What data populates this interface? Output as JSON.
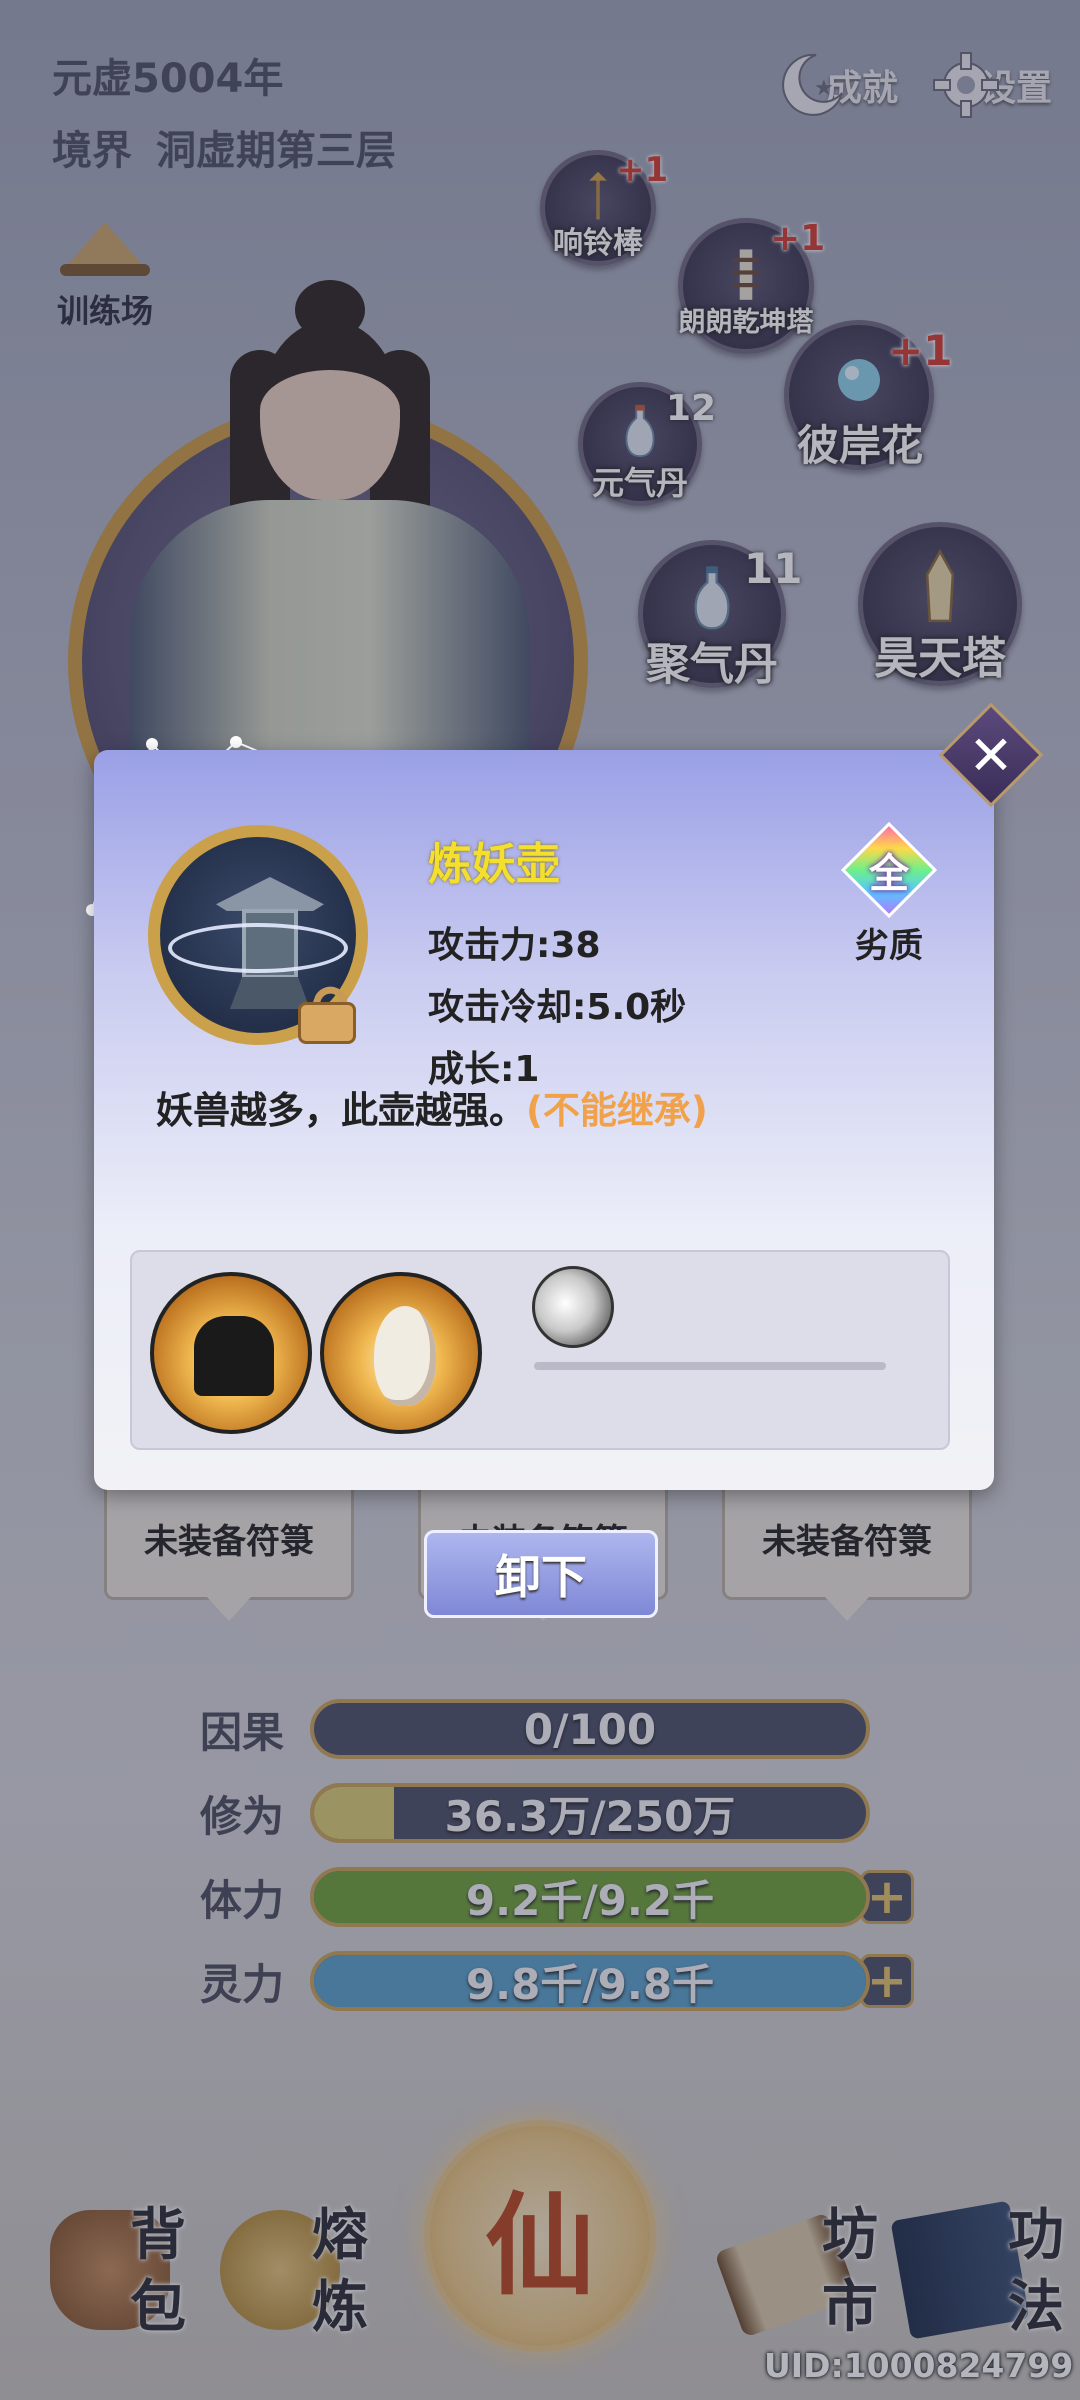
{
  "header": {
    "era": "元虚5004年",
    "realm_label": "境界",
    "realm_value": "洞虚期第三层",
    "achievements_label": "成就",
    "settings_label": "设置"
  },
  "training": {
    "label": "训练场"
  },
  "inventory_items": [
    {
      "name": "响铃棒",
      "badge": "+1",
      "badge_type": "plus"
    },
    {
      "name": "朗朗乾坤塔",
      "badge": "+1",
      "badge_type": "plus"
    },
    {
      "name": "彼岸花",
      "badge": "+1",
      "badge_type": "plus"
    },
    {
      "name": "元气丹",
      "badge": "12",
      "badge_type": "count"
    },
    {
      "name": "聚气丹",
      "badge": "11",
      "badge_type": "count"
    },
    {
      "name": "昊天塔",
      "badge": "",
      "badge_type": "none"
    }
  ],
  "modal": {
    "title": "炼妖壶",
    "attack": "攻击力:38",
    "cooldown": "攻击冷却:5.0秒",
    "growth": "成长:1",
    "description": "妖兽越多，此壶越强。",
    "note": "(不能继承)",
    "rank_glyph": "全",
    "rank_label": "劣质",
    "close_symbol": "✕",
    "progress_fraction": 0
  },
  "talisman_slots": [
    "未装备符箓",
    "未装备符箓",
    "未装备符箓"
  ],
  "unload_label": "卸下",
  "stats": [
    {
      "label": "因果",
      "text": "0/100",
      "fraction": 0,
      "color": "#4c5068"
    },
    {
      "label": "修为",
      "text": "36.3万/250万",
      "fraction": 0.145,
      "color": "#d9cb74"
    },
    {
      "label": "体力",
      "text": "9.2千/9.2千",
      "fraction": 1,
      "color": "#6fa03a",
      "plus": "+"
    },
    {
      "label": "灵力",
      "text": "9.8千/9.8千",
      "fraction": 1,
      "color": "#5aa0c8",
      "plus": "+"
    }
  ],
  "bottom_nav": {
    "bag": [
      "背",
      "包"
    ],
    "smelt": [
      "熔",
      "炼"
    ],
    "center": "仙",
    "market": [
      "坊",
      "市"
    ],
    "skills": [
      "功",
      "法"
    ]
  },
  "uid": "UID:1000824799"
}
